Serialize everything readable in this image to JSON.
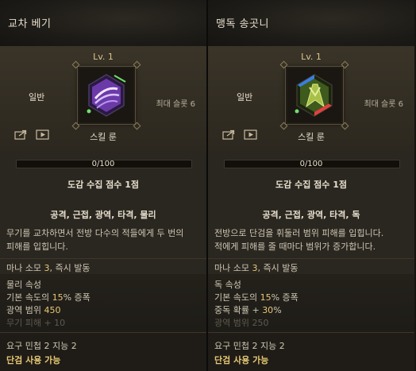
{
  "panels": [
    {
      "title": "교차 베기",
      "level": "Lv. 1",
      "grade": "일반",
      "max_slot": "최대 슬롯 6",
      "rune_label": "스킬 룬",
      "progress": "0/100",
      "progress_fraction": 0,
      "score": "도감 수집 점수 1점",
      "tags": "공격, 근접, 광역, 타격, 물리",
      "description": [
        "무기를 교차하면서 전방 다수의 적들에게 두 번의",
        "피해를 입힙니다."
      ],
      "mana_prefix": "마나 소모 ",
      "mana_value": "3",
      "mana_suffix": ", 즉시 발동",
      "stats": [
        {
          "text": "물리 속성",
          "highlight": ""
        },
        {
          "text": "기본 속도의 ",
          "highlight": "15",
          "suffix": "% 증폭"
        },
        {
          "text": "광역 범위 ",
          "highlight": "450",
          "suffix": ""
        },
        {
          "text": "무기 피해 + 10",
          "highlight": "",
          "suffix": ""
        }
      ],
      "requirement": "요구 민첩 2 지능 2",
      "usable": "단검 사용 가능",
      "icon": "cross-slash-icon",
      "accent": "#b37dff"
    },
    {
      "title": "맹독 송곳니",
      "level": "Lv. 1",
      "grade": "일반",
      "max_slot": "최대 슬롯 6",
      "rune_label": "스킬 룬",
      "progress": "0/100",
      "progress_fraction": 0,
      "score": "도감 수집 점수 1점",
      "tags": "공격, 근접, 광역, 타격, 독",
      "description": [
        "전방으로 단검을 휘둘러 범위 피해를 입힙니다.",
        "적에게 피해를 줄 때마다 범위가 증가합니다."
      ],
      "mana_prefix": "마나 소모 ",
      "mana_value": "3",
      "mana_suffix": ", 즉시 발동",
      "stats": [
        {
          "text": "독 속성",
          "highlight": ""
        },
        {
          "text": "기본 속도의 ",
          "highlight": "15",
          "suffix": "% 증폭"
        },
        {
          "text": "중독 확률 + ",
          "highlight": "30",
          "suffix": "%"
        },
        {
          "text": "광역 범위 250",
          "highlight": "",
          "suffix": ""
        }
      ],
      "requirement": "요구 민첩 2 지능 2",
      "usable": "단검 사용 가능",
      "icon": "venom-fang-icon",
      "accent": "#8fbf3a"
    }
  ]
}
